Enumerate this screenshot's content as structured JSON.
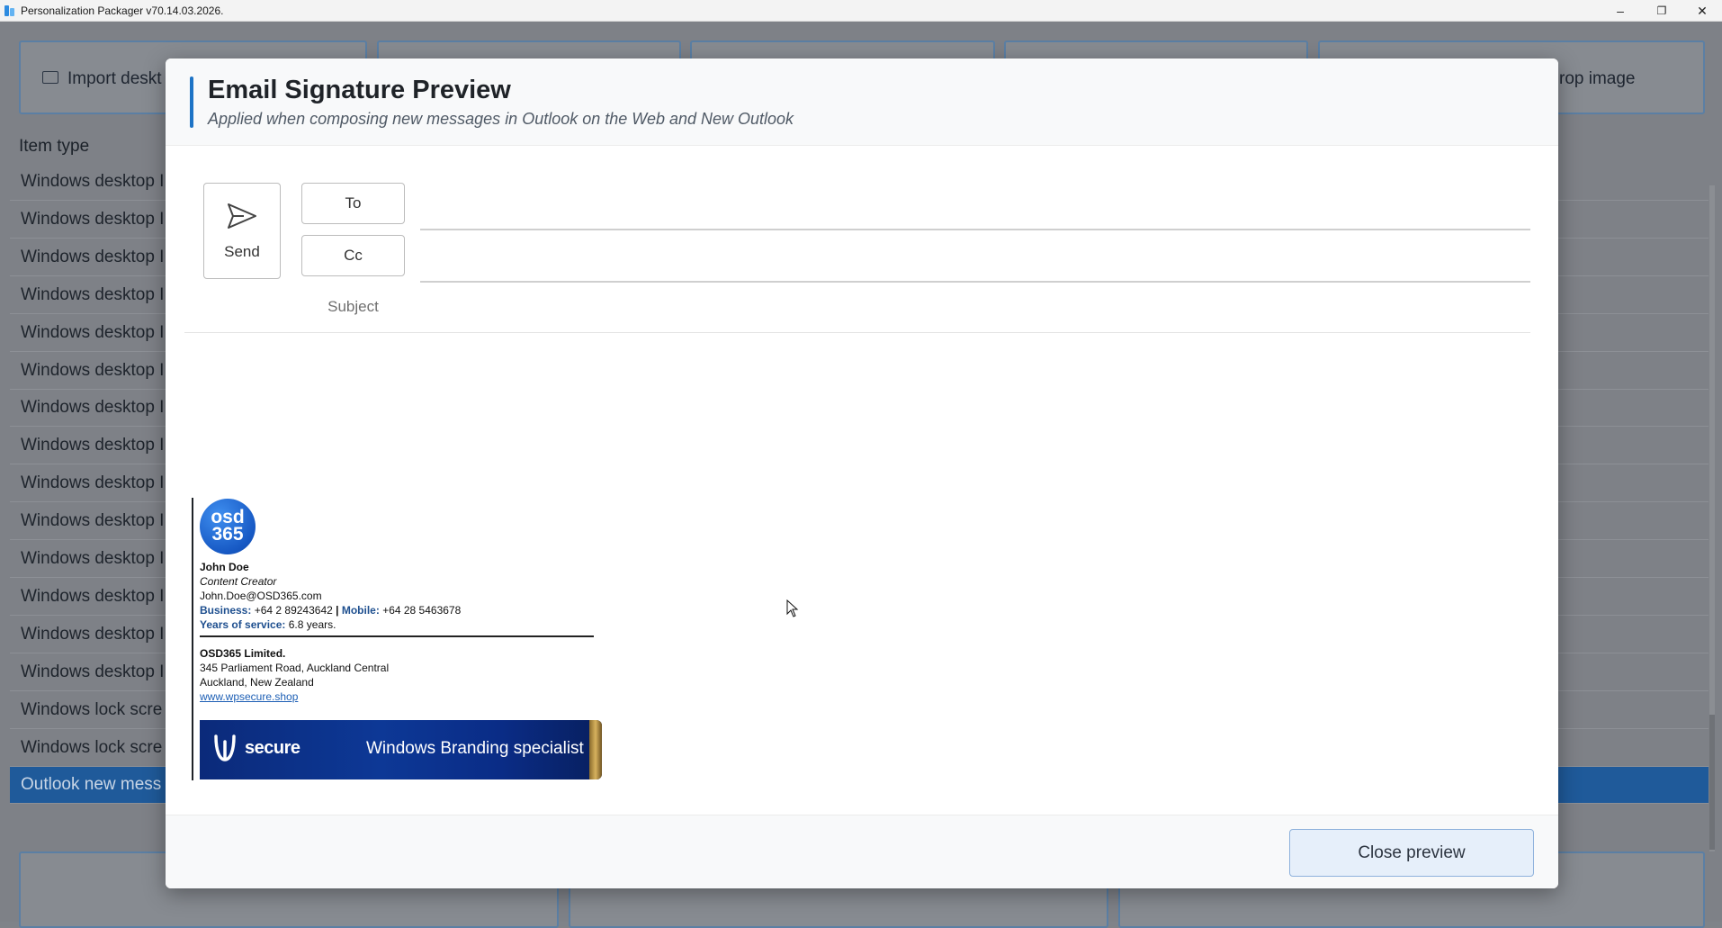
{
  "window": {
    "title": "Personalization Packager v70.14.03.2026.",
    "minimize": "–",
    "maximize": "❐",
    "close": "✕"
  },
  "background": {
    "toolbar_buttons": [
      {
        "label": "Import deskt"
      },
      {
        "label": ""
      },
      {
        "label": ""
      },
      {
        "label": ""
      },
      {
        "label": "rop image"
      }
    ],
    "list_header": "Item type",
    "rows": [
      "Windows desktop I",
      "Windows desktop I",
      "Windows desktop I",
      "Windows desktop I",
      "Windows desktop I",
      "Windows desktop I",
      "Windows desktop I",
      "Windows desktop I",
      "Windows desktop I",
      "Windows desktop I",
      "Windows desktop I",
      "Windows desktop I",
      "Windows desktop I",
      "Windows desktop I",
      "Windows lock scre",
      "Windows lock scre",
      "Outlook new mess"
    ],
    "selected_row_index": 16
  },
  "modal": {
    "title": "Email Signature Preview",
    "subtitle": "Applied when composing new messages in Outlook on the Web and New Outlook",
    "compose": {
      "send_label": "Send",
      "to_label": "To",
      "cc_label": "Cc",
      "subject_label": "Subject"
    },
    "signature": {
      "logo_line1": "osd",
      "logo_line2": "365",
      "name": "John Doe",
      "role": "Content Creator",
      "email": "John.Doe@OSD365.com",
      "business_label": "Business:",
      "business_phone": "+64 2 89243642",
      "separator": "|",
      "mobile_label": "Mobile:",
      "mobile_phone": "+64 28 5463678",
      "service_label": "Years of service:",
      "service_value": "6.8 years.",
      "company": "OSD365 Limited.",
      "address1": "345 Parliament Road, Auckland Central",
      "address2": "Auckland, New Zealand",
      "website": "www.wpsecure.shop",
      "banner_brand": "secure",
      "banner_tagline": "Windows Branding specialist"
    },
    "close_label": "Close preview"
  },
  "colors": {
    "accent": "#1e74c6",
    "selected_row": "#1f5a9a",
    "banner": "#0d3896"
  }
}
